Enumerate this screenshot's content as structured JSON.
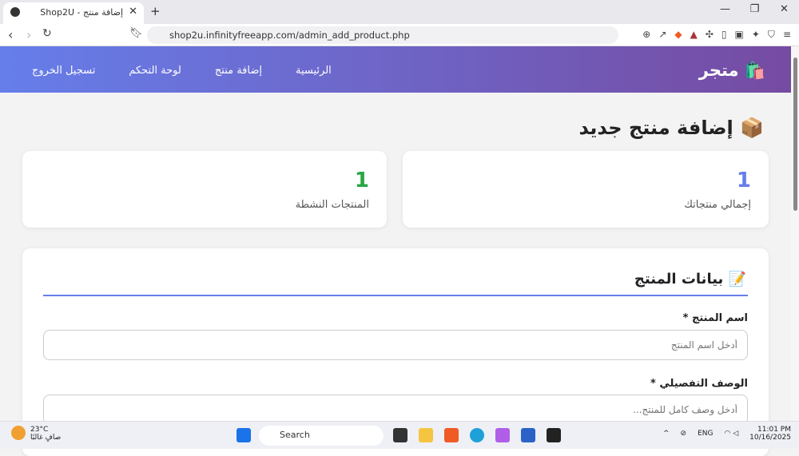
{
  "browser": {
    "tab_title": "إضافة منتج - Shop2U",
    "url": "shop2u.infinityfreeapp.com/admin_add_product.php"
  },
  "header": {
    "brand": "متجر",
    "nav": [
      "الرئيسية",
      "إضافة منتج",
      "لوحة التحكم",
      "تسجيل الخروج"
    ]
  },
  "page": {
    "title": "إضافة منتج جديد",
    "stats": [
      {
        "value": "1",
        "label": "إجمالي منتجاتك",
        "color": "#667eea"
      },
      {
        "value": "1",
        "label": "المنتجات النشطة",
        "color": "#28a745"
      }
    ],
    "form": {
      "title": "بيانات المنتج",
      "name_label": "اسم المنتج *",
      "name_placeholder": "أدخل اسم المنتج",
      "desc_label": "الوصف التفصيلي *",
      "desc_placeholder": "أدخل وصف كامل للمنتج..."
    }
  },
  "taskbar": {
    "temp": "23°C",
    "weather": "صافٍ غالبًا",
    "search": "Search",
    "lang": "ENG",
    "time": "11:01 PM",
    "date": "10/16/2025"
  }
}
